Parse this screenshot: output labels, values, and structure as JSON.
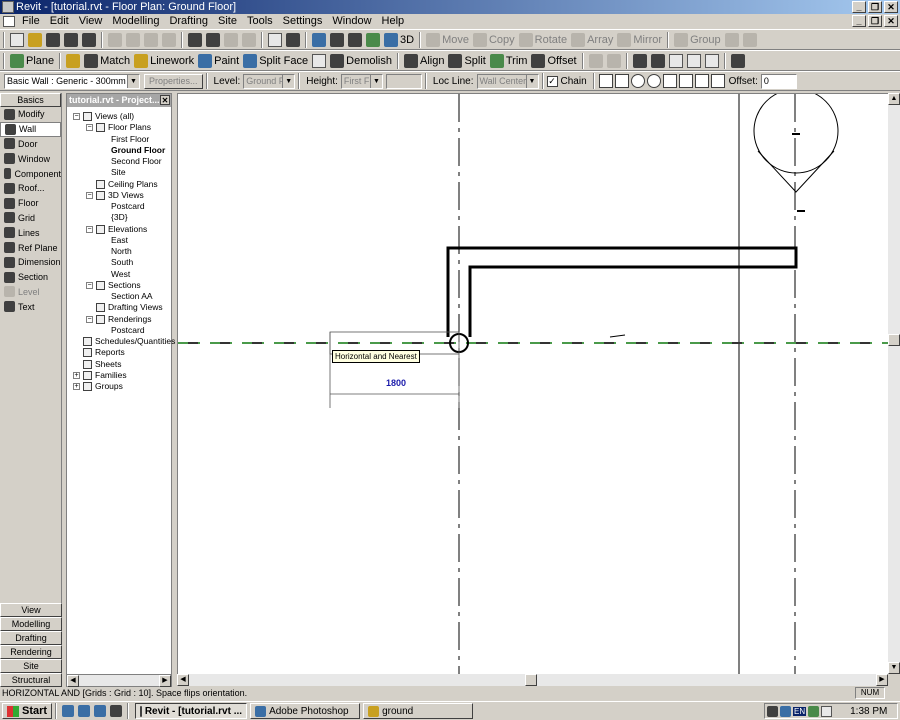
{
  "window": {
    "title": "Revit - [tutorial.rvt - Floor Plan: Ground Floor]"
  },
  "menu": [
    "File",
    "Edit",
    "View",
    "Modelling",
    "Drafting",
    "Site",
    "Tools",
    "Settings",
    "Window",
    "Help"
  ],
  "toolbar1": {
    "view_3d": "3D",
    "move": "Move",
    "copy": "Copy",
    "rotate": "Rotate",
    "array": "Array",
    "mirror": "Mirror",
    "group": "Group"
  },
  "toolbar2": {
    "plane": "Plane",
    "match": "Match",
    "linework": "Linework",
    "paint": "Paint",
    "split_face": "Split Face",
    "demolish": "Demolish",
    "align": "Align",
    "split": "Split",
    "trim": "Trim",
    "offset": "Offset"
  },
  "options_bar": {
    "type_selector": "Basic Wall : Generic - 300mm",
    "properties": "Properties...",
    "level_label": "Level:",
    "level_value": "Ground Flc",
    "height_label": "Height:",
    "height_value": "First Flo",
    "locline_label": "Loc Line:",
    "locline_value": "Wall Centerlin",
    "chain_label": "Chain",
    "chain_checked": true,
    "offset_label": "Offset:",
    "offset_value": "0"
  },
  "design_bar": {
    "active_tab": "Basics",
    "items": [
      {
        "label": "Modify",
        "icon": "arrow-cursor-icon"
      },
      {
        "label": "Wall",
        "icon": "wall-icon",
        "active": true
      },
      {
        "label": "Door",
        "icon": "door-icon"
      },
      {
        "label": "Window",
        "icon": "window-icon"
      },
      {
        "label": "Component",
        "icon": "component-icon"
      },
      {
        "label": "Roof...",
        "icon": "roof-icon"
      },
      {
        "label": "Floor",
        "icon": "floor-icon"
      },
      {
        "label": "Grid",
        "icon": "grid-icon"
      },
      {
        "label": "Lines",
        "icon": "lines-icon"
      },
      {
        "label": "Ref Plane",
        "icon": "ref-plane-icon"
      },
      {
        "label": "Dimension",
        "icon": "dimension-icon"
      },
      {
        "label": "Section",
        "icon": "section-icon"
      },
      {
        "label": "Level",
        "icon": "level-icon",
        "disabled": true
      },
      {
        "label": "Text",
        "icon": "text-icon"
      }
    ],
    "bottom_tabs": [
      "View",
      "Modelling",
      "Drafting",
      "Rendering",
      "Site",
      "Structural"
    ]
  },
  "project_browser": {
    "title": "tutorial.rvt - Project...",
    "nodes": [
      {
        "label": "Views (all)",
        "level": 0
      },
      {
        "label": "Floor Plans",
        "level": 1
      },
      {
        "label": "First Floor",
        "level": 2
      },
      {
        "label": "Ground Floor",
        "level": 2,
        "bold": true
      },
      {
        "label": "Second Floor",
        "level": 2
      },
      {
        "label": "Site",
        "level": 2
      },
      {
        "label": "Ceiling Plans",
        "level": 1
      },
      {
        "label": "3D Views",
        "level": 1
      },
      {
        "label": "Postcard",
        "level": 2
      },
      {
        "label": "{3D}",
        "level": 2
      },
      {
        "label": "Elevations",
        "level": 1
      },
      {
        "label": "East",
        "level": 2
      },
      {
        "label": "North",
        "level": 2
      },
      {
        "label": "South",
        "level": 2
      },
      {
        "label": "West",
        "level": 2
      },
      {
        "label": "Sections",
        "level": 1
      },
      {
        "label": "Section AA",
        "level": 2
      },
      {
        "label": "Drafting Views",
        "level": 1
      },
      {
        "label": "Renderings",
        "level": 1
      },
      {
        "label": "Postcard",
        "level": 2
      },
      {
        "label": "Schedules/Quantities",
        "level": 0
      },
      {
        "label": "Reports",
        "level": 0
      },
      {
        "label": "Sheets",
        "level": 0
      },
      {
        "label": "Families",
        "level": 0
      },
      {
        "label": "Groups",
        "level": 0
      }
    ]
  },
  "canvas": {
    "tooltip": "Horizontal and Nearest",
    "dimension": "1800"
  },
  "status_bar": {
    "message": "HORIZONTAL AND [Grids : Grid : 10]. Space flips orientation.",
    "num": "NUM"
  },
  "taskbar": {
    "start": "Start",
    "tasks": [
      {
        "label": "Revit - [tutorial.rvt ...",
        "active": true
      },
      {
        "label": "Adobe Photoshop",
        "active": false
      },
      {
        "label": "ground",
        "active": false
      }
    ],
    "lang": "EN",
    "clock": "1:38 PM"
  }
}
